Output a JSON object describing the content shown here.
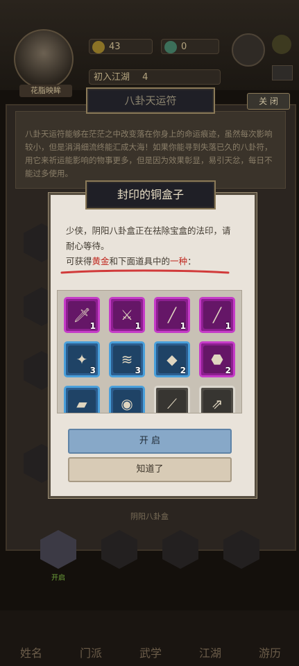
{
  "header": {
    "avatar_name": "花脂映眸",
    "gold": "43",
    "jade": "0",
    "line3": "",
    "join_label": "初入江湖",
    "join_value": "4"
  },
  "bagua_panel": {
    "title": "八卦天运符",
    "close_label": "关 闭",
    "description": "八卦天运符能够在茫茫之中改变落在你身上的命运痕迹，虽然每次影响较小，但是涓涓细流终能汇成大海！如果你能寻到失落已久的八卦符，用它来祈运能影响的物事更多，但是因为效果彰显，易引天忿，每日不能过多使用。"
  },
  "box_section": {
    "label": "阴阳八卦盒",
    "slot1_label": "开启"
  },
  "modal": {
    "title": "封印的铜盒子",
    "text_line1": "少侠，阴阳八卦盒正在祛除宝盒的法印，请耐心等待。",
    "line2_prefix": "可获得",
    "line2_gold": "黄金",
    "line2_mid": "和下面道具中的",
    "line2_one": "一种",
    "line2_suffix": "：",
    "items": [
      {
        "icon": "sword-icon",
        "rarity": "purple",
        "count": "1"
      },
      {
        "icon": "saber-icon",
        "rarity": "purple",
        "count": "1"
      },
      {
        "icon": "spear-icon",
        "rarity": "purple",
        "count": "1"
      },
      {
        "icon": "staff-icon",
        "rarity": "purple",
        "count": "1"
      },
      {
        "icon": "gem-cloth-icon",
        "rarity": "blue",
        "count": "3"
      },
      {
        "icon": "scroll-icon",
        "rarity": "blue",
        "count": "3"
      },
      {
        "icon": "blade-ore-icon",
        "rarity": "blue",
        "count": "2"
      },
      {
        "icon": "stone-icon",
        "rarity": "purple",
        "count": "2"
      },
      {
        "icon": "gold-ingot-icon",
        "rarity": "blue",
        "count": ""
      },
      {
        "icon": "silk-roll-icon",
        "rarity": "blue",
        "count": ""
      },
      {
        "icon": "brush-icon",
        "rarity": "white",
        "count": ""
      },
      {
        "icon": "arrows-icon",
        "rarity": "white",
        "count": ""
      }
    ],
    "open_button": "开 启",
    "ok_button": "知道了"
  },
  "bottom_nav": [
    "姓名",
    "门派",
    "武学",
    "江湖",
    "游历"
  ],
  "colors": {
    "purple": "#8c1f8f",
    "blue": "#2c5d8e",
    "white": "#dcd8cf",
    "red_text": "#c0281f"
  }
}
